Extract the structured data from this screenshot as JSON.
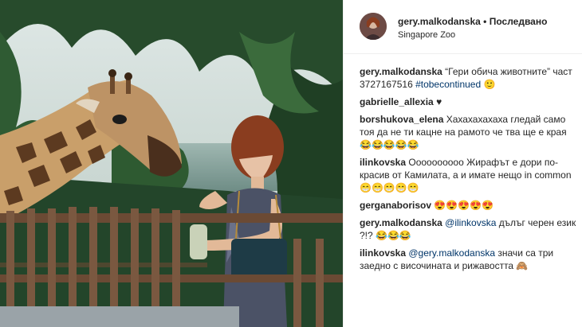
{
  "post": {
    "username": "gery.malkodanska",
    "separator": "•",
    "follow_label": "Последвано",
    "location": "Singapore Zoo"
  },
  "comments": [
    {
      "user": "gery.malkodanska",
      "parts": [
        "“Гери обича животните” част 3727167516 ",
        "#tobecontinued",
        " 🙂"
      ]
    },
    {
      "user": "gabrielle_allexia",
      "parts": [
        "♥"
      ]
    },
    {
      "user": "borshukova_elena",
      "parts": [
        "Хахахахахаха гледай само тоя да не ти кацне на рамото че тва ще е края 😂😂😂😂😂"
      ]
    },
    {
      "user": "ilinkovska",
      "parts": [
        "Оооооооооо Жирафът е дори по-красив от Камилата, а и имате нещо in common 😁😁😁😁😁"
      ]
    },
    {
      "user": "gerganaborisov",
      "parts": [
        "😍😍😍😍😍"
      ]
    },
    {
      "user": "gery.malkodanska",
      "parts": [
        "@ilinkovska",
        " дълъг черен език ?!? 😂😂😂"
      ]
    },
    {
      "user": "ilinkovska",
      "parts": [
        "@gery.malkodanska",
        " значи са три заедно с височината и рижавостта 🙈"
      ]
    }
  ],
  "colors": {
    "link": "#003569",
    "text": "#262626",
    "border": "#efefef"
  }
}
